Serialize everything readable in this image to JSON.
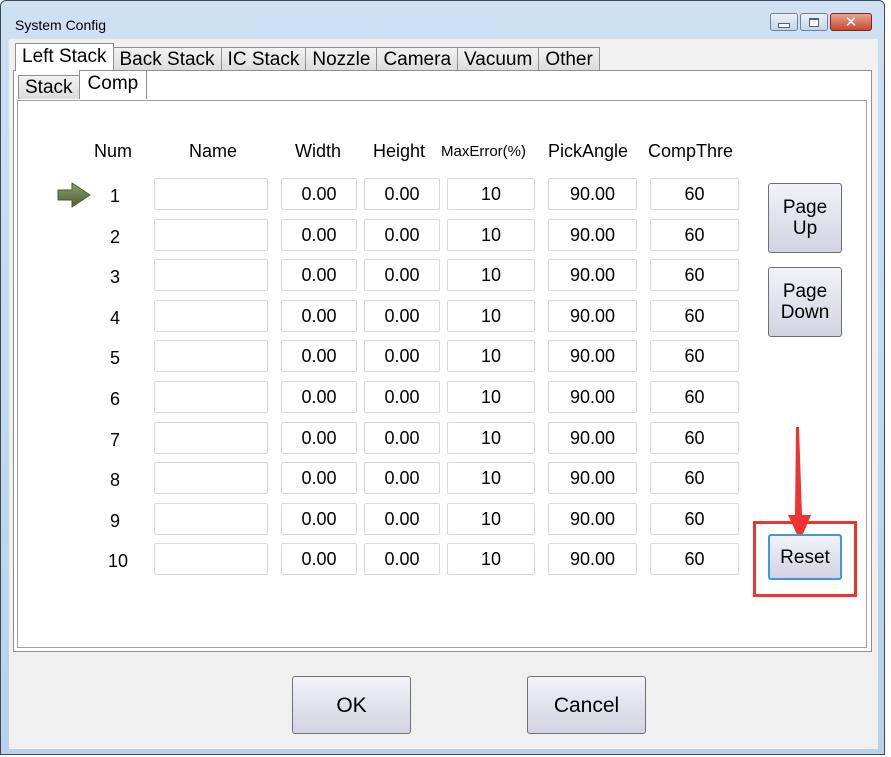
{
  "window": {
    "title": "System Config",
    "controls": [
      "minimize",
      "maximize",
      "close"
    ]
  },
  "main_tabs": [
    {
      "label": "Left Stack",
      "active": true
    },
    {
      "label": "Back Stack",
      "active": false
    },
    {
      "label": "IC Stack",
      "active": false
    },
    {
      "label": "Nozzle",
      "active": false
    },
    {
      "label": "Camera",
      "active": false
    },
    {
      "label": "Vacuum",
      "active": false
    },
    {
      "label": "Other",
      "active": false
    }
  ],
  "sub_tabs": [
    {
      "label": "Stack",
      "active": false
    },
    {
      "label": "Comp",
      "active": true
    }
  ],
  "table": {
    "headers": {
      "num": "Num",
      "name": "Name",
      "width": "Width",
      "height": "Height",
      "max_error": "MaxError(%)",
      "pick_angle": "PickAngle",
      "comp_thre": "CompThre"
    },
    "current_row_indicator": "arrow-right-icon",
    "rows": [
      {
        "num": "1",
        "name": "",
        "width": "0.00",
        "height": "0.00",
        "max_error": "10",
        "pick_angle": "90.00",
        "comp_thre": "60"
      },
      {
        "num": "2",
        "name": "",
        "width": "0.00",
        "height": "0.00",
        "max_error": "10",
        "pick_angle": "90.00",
        "comp_thre": "60"
      },
      {
        "num": "3",
        "name": "",
        "width": "0.00",
        "height": "0.00",
        "max_error": "10",
        "pick_angle": "90.00",
        "comp_thre": "60"
      },
      {
        "num": "4",
        "name": "",
        "width": "0.00",
        "height": "0.00",
        "max_error": "10",
        "pick_angle": "90.00",
        "comp_thre": "60"
      },
      {
        "num": "5",
        "name": "",
        "width": "0.00",
        "height": "0.00",
        "max_error": "10",
        "pick_angle": "90.00",
        "comp_thre": "60"
      },
      {
        "num": "6",
        "name": "",
        "width": "0.00",
        "height": "0.00",
        "max_error": "10",
        "pick_angle": "90.00",
        "comp_thre": "60"
      },
      {
        "num": "7",
        "name": "",
        "width": "0.00",
        "height": "0.00",
        "max_error": "10",
        "pick_angle": "90.00",
        "comp_thre": "60"
      },
      {
        "num": "8",
        "name": "",
        "width": "0.00",
        "height": "0.00",
        "max_error": "10",
        "pick_angle": "90.00",
        "comp_thre": "60"
      },
      {
        "num": "9",
        "name": "",
        "width": "0.00",
        "height": "0.00",
        "max_error": "10",
        "pick_angle": "90.00",
        "comp_thre": "60"
      },
      {
        "num": "10",
        "name": "",
        "width": "0.00",
        "height": "0.00",
        "max_error": "10",
        "pick_angle": "90.00",
        "comp_thre": "60"
      }
    ]
  },
  "side_buttons": {
    "page_up": [
      "Page",
      "Up"
    ],
    "page_down": [
      "Page",
      "Down"
    ],
    "reset": "Reset"
  },
  "footer": {
    "ok": "OK",
    "cancel": "Cancel"
  },
  "annotation": {
    "highlight_color": "#ee3333",
    "target": "Reset"
  }
}
